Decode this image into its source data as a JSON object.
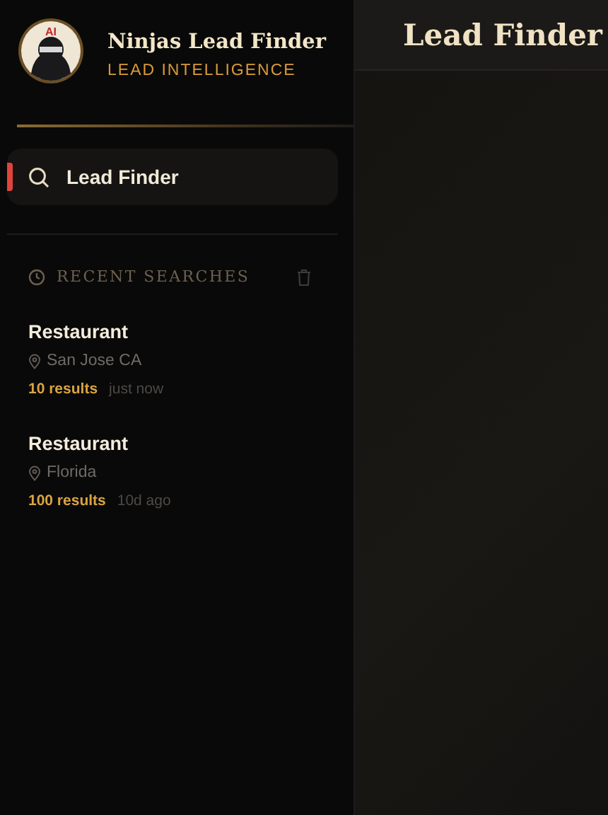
{
  "brand": {
    "logo_badge": "AI",
    "title": "Ninjas Lead Finder",
    "subtitle": "LEAD INTELLIGENCE"
  },
  "nav": [
    {
      "label": "Lead Finder",
      "selected": true
    }
  ],
  "recent_searches": {
    "heading": "RECENT SEARCHES",
    "items": [
      {
        "query": "Restaurant",
        "location": "San Jose CA",
        "results": "10 results",
        "time": "just now"
      },
      {
        "query": "Restaurant",
        "location": "Florida",
        "results": "100 results",
        "time": "10d ago"
      }
    ]
  },
  "page": {
    "title": "Lead Finder"
  }
}
